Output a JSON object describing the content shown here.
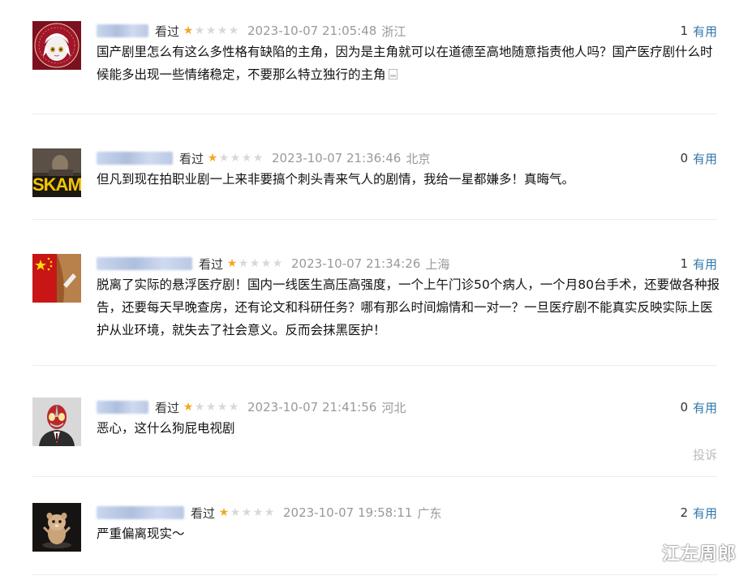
{
  "reviews": [
    {
      "status": "看过",
      "rating": 1,
      "time": "2023-10-07 21:05:48",
      "location": "浙江",
      "votes": "1",
      "useful_label": "有用",
      "content": "国产剧里怎么有这么多性格有缺陷的主角，因为是主角就可以在道德至高地随意指责他人吗？国产医疗剧什么时候能多出现一些情绪稳定，不要那么特立独行的主角",
      "has_image_icon": true,
      "avatar": "anime-girl-avatar"
    },
    {
      "status": "看过",
      "rating": 1,
      "time": "2023-10-07 21:36:46",
      "location": "北京",
      "votes": "0",
      "useful_label": "有用",
      "content": "但凡到现在拍职业剧一上来非要搞个刺头青来气人的剧情，我给一星都嫌多！真晦气。",
      "avatar": "skam-poster-avatar",
      "avatar_text": "SKAM"
    },
    {
      "status": "看过",
      "rating": 1,
      "time": "2023-10-07 21:34:26",
      "location": "上海",
      "votes": "1",
      "useful_label": "有用",
      "content": "脱离了实际的悬浮医疗剧！国内一线医生高压高强度，一个上午门诊50个病人，一个月80台手术，还要做各种报告，还要每天早晚查房，还有论文和科研任务？哪有那么时间煽情和一对一？一旦医疗剧不能真实反映实际上医护从业环境，就失去了社会意义。反而会抹黑医护！",
      "avatar": "flag-avatar"
    },
    {
      "status": "看过",
      "rating": 1,
      "time": "2023-10-07 21:41:56",
      "location": "河北",
      "votes": "0",
      "useful_label": "有用",
      "content": "恶心，这什么狗屁电视剧",
      "report_label": "投诉",
      "avatar": "ultraman-suit-avatar"
    },
    {
      "status": "看过",
      "rating": 1,
      "time": "2023-10-07 19:58:11",
      "location": "广东",
      "votes": "2",
      "useful_label": "有用",
      "content": "严重偏离现实～",
      "avatar": "hamster-avatar"
    }
  ],
  "watermark": "江左周郎",
  "colors": {
    "star_on": "#f5a623",
    "star_off": "#d8d8d8",
    "link": "#3377aa",
    "meta_gray": "#999999"
  }
}
